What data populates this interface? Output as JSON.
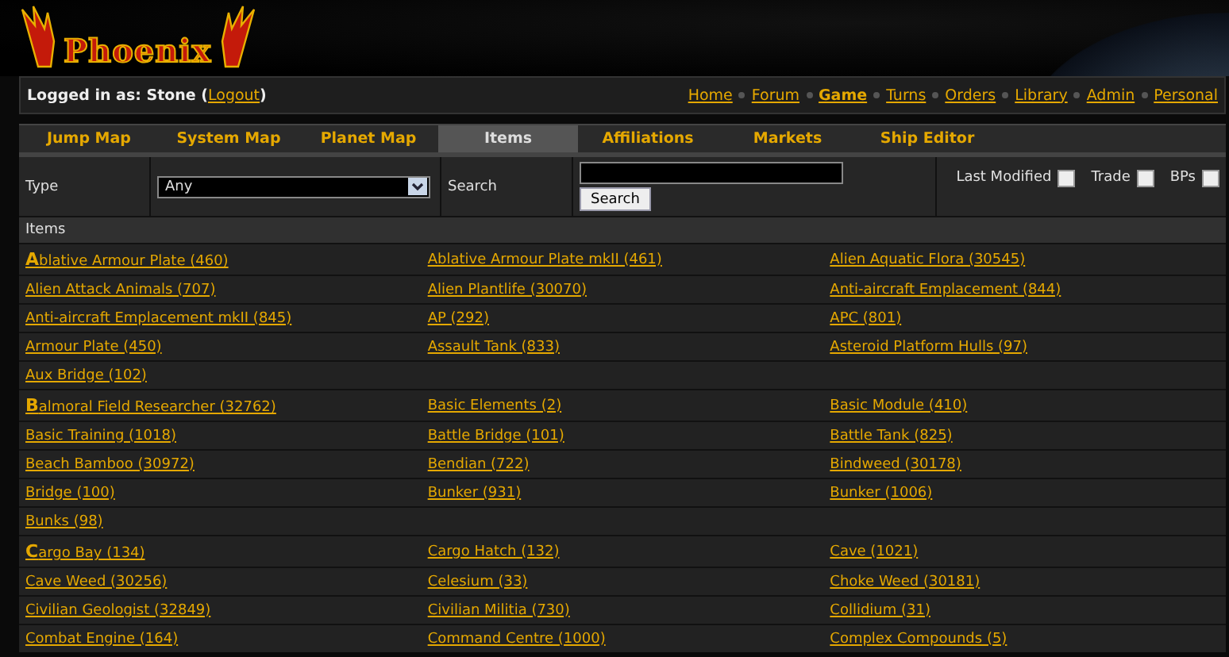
{
  "logo": {
    "text": "Phoenix"
  },
  "login": {
    "prefix": "Logged in as: Stone (",
    "link": "Logout",
    "suffix": ")"
  },
  "nav": [
    {
      "label": "Home",
      "selected": false
    },
    {
      "label": "Forum",
      "selected": false
    },
    {
      "label": "Game",
      "selected": true
    },
    {
      "label": "Turns",
      "selected": false
    },
    {
      "label": "Orders",
      "selected": false
    },
    {
      "label": "Library",
      "selected": false
    },
    {
      "label": "Admin",
      "selected": false
    },
    {
      "label": "Personal",
      "selected": false
    }
  ],
  "tabs": [
    {
      "label": "Jump Map",
      "selected": false
    },
    {
      "label": "System Map",
      "selected": false
    },
    {
      "label": "Planet Map",
      "selected": false
    },
    {
      "label": "Items",
      "selected": true
    },
    {
      "label": "Affiliations",
      "selected": false
    },
    {
      "label": "Markets",
      "selected": false
    },
    {
      "label": "Ship Editor",
      "selected": false
    }
  ],
  "filters": {
    "type_label": "Type",
    "type_value": "Any",
    "search_label": "Search",
    "search_button": "Search",
    "checks": [
      {
        "label": "Last Modified",
        "checked": false
      },
      {
        "label": "Trade",
        "checked": false
      },
      {
        "label": "BPs",
        "checked": false
      }
    ]
  },
  "table": {
    "heading": "Items",
    "groups": [
      {
        "rows": [
          [
            "**A**blative Armour Plate (460)",
            "Ablative Armour Plate mkII (461)",
            "Alien Aquatic Flora (30545)"
          ],
          [
            "Alien Attack Animals (707)",
            "Alien Plantlife (30070)",
            "Anti-aircraft Emplacement (844)"
          ],
          [
            "Anti-aircraft Emplacement mkII (845)",
            "AP (292)",
            "APC (801)"
          ],
          [
            "Armour Plate (450)",
            "Assault Tank (833)",
            "Asteroid Platform Hulls (97)"
          ],
          [
            "Aux Bridge (102)"
          ]
        ]
      },
      {
        "rows": [
          [
            "**B**almoral Field Researcher (32762)",
            "Basic Elements (2)",
            "Basic Module (410)"
          ],
          [
            "Basic Training (1018)",
            "Battle Bridge (101)",
            "Battle Tank (825)"
          ],
          [
            "Beach Bamboo (30972)",
            "Bendian (722)",
            "Bindweed (30178)"
          ],
          [
            "Bridge (100)",
            "Bunker (931)",
            "Bunker (1006)"
          ],
          [
            "Bunks (98)"
          ]
        ]
      },
      {
        "rows": [
          [
            "**C**argo Bay (134)",
            "Cargo Hatch (132)",
            "Cave (1021)"
          ],
          [
            "Cave Weed (30256)",
            "Celesium (33)",
            "Choke Weed (30181)"
          ],
          [
            "Civilian Geologist (32849)",
            "Civilian Militia (730)",
            "Collidium (31)"
          ],
          [
            "Combat Engine (164)",
            "Command Centre (1000)",
            "Complex Compounds (5)"
          ]
        ]
      }
    ]
  }
}
